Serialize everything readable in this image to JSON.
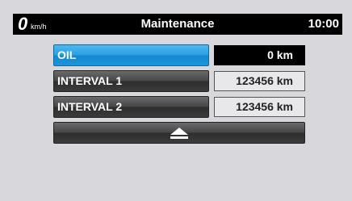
{
  "status": {
    "speed": "0",
    "speed_unit": "km/h",
    "title": "Maintenance",
    "clock": "10:00"
  },
  "rows": [
    {
      "label": "OIL",
      "value": "0 km",
      "selected": true
    },
    {
      "label": "INTERVAL 1",
      "value": "123456 km",
      "selected": false
    },
    {
      "label": "INTERVAL 2",
      "value": "123456 km",
      "selected": false
    }
  ],
  "up_button": {
    "icon": "triangle-up-icon"
  },
  "colors": {
    "selected": "#2aa0e2",
    "button": "#474747",
    "background": "#d8d7dc",
    "statusbar": "#000000"
  }
}
